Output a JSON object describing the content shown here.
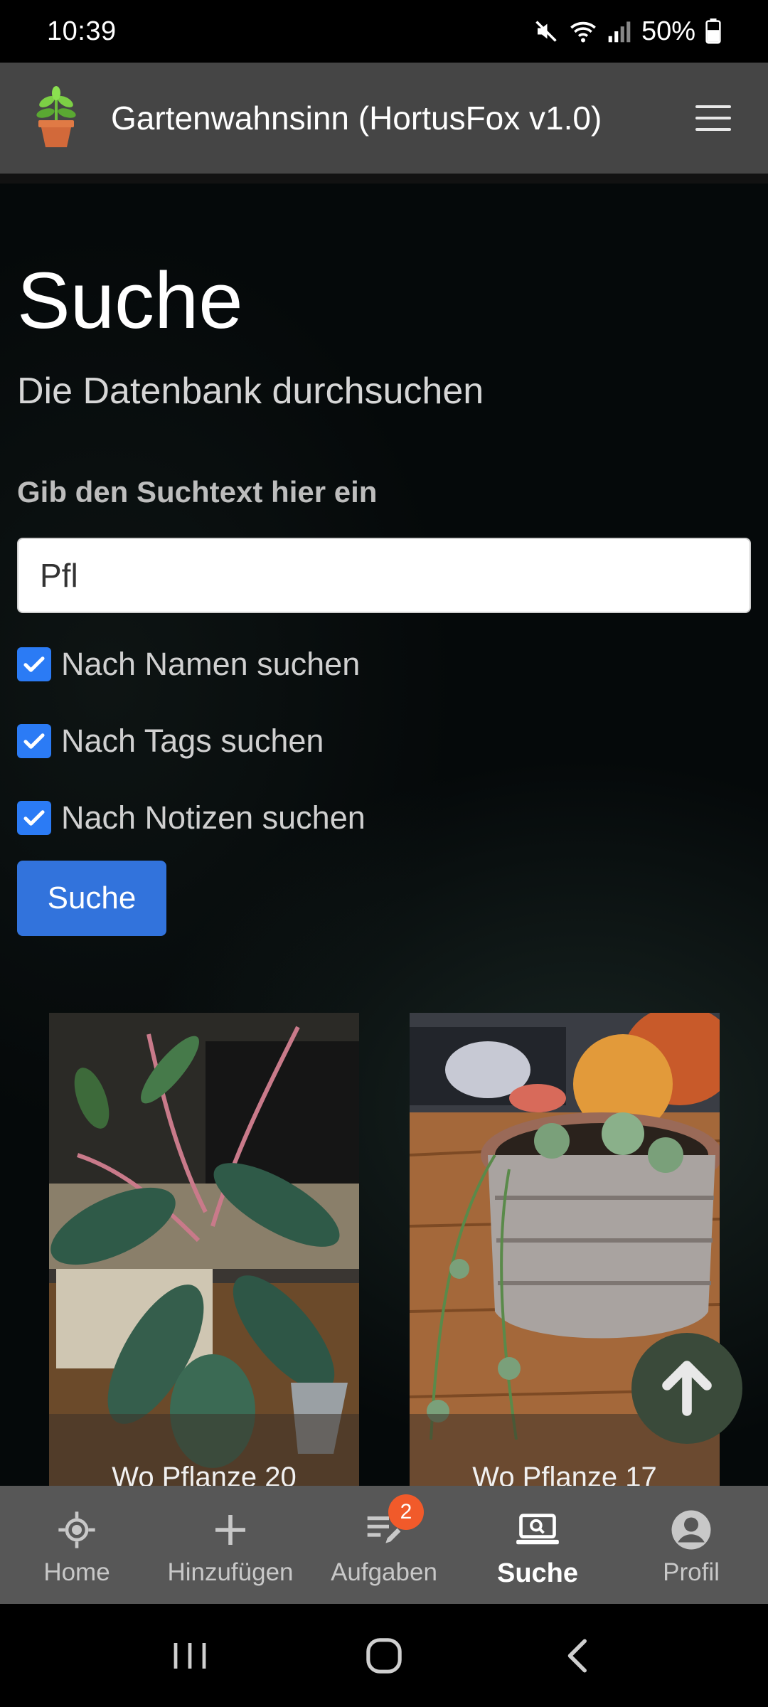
{
  "status": {
    "time": "10:39",
    "battery": "50%"
  },
  "header": {
    "title": "Gartenwahnsinn (HortusFox v1.0)"
  },
  "main": {
    "title": "Suche",
    "subtitle": "Die Datenbank durchsuchen",
    "search_label": "Gib den Suchtext hier ein",
    "search_value": "Pfl",
    "checkboxes": [
      {
        "label": "Nach Namen suchen",
        "checked": true
      },
      {
        "label": "Nach Tags suchen",
        "checked": true
      },
      {
        "label": "Nach Notizen suchen",
        "checked": true
      }
    ],
    "search_button": "Suche",
    "results": [
      {
        "name": "Wo Pflanze 20"
      },
      {
        "name": "Wo Pflanze 17"
      }
    ]
  },
  "nav": {
    "items": [
      {
        "label": "Home",
        "icon": "home-icon"
      },
      {
        "label": "Hinzufügen",
        "icon": "plus-icon"
      },
      {
        "label": "Aufgaben",
        "icon": "tasks-icon",
        "badge": "2"
      },
      {
        "label": "Suche",
        "icon": "search-laptop-icon",
        "active": true
      },
      {
        "label": "Profil",
        "icon": "profile-icon"
      }
    ]
  },
  "colors": {
    "accent": "#3273dc",
    "checkbox": "#2b7bf5",
    "badge": "#f15a2a",
    "header_bg": "#454545",
    "nav_bg": "#575757"
  }
}
